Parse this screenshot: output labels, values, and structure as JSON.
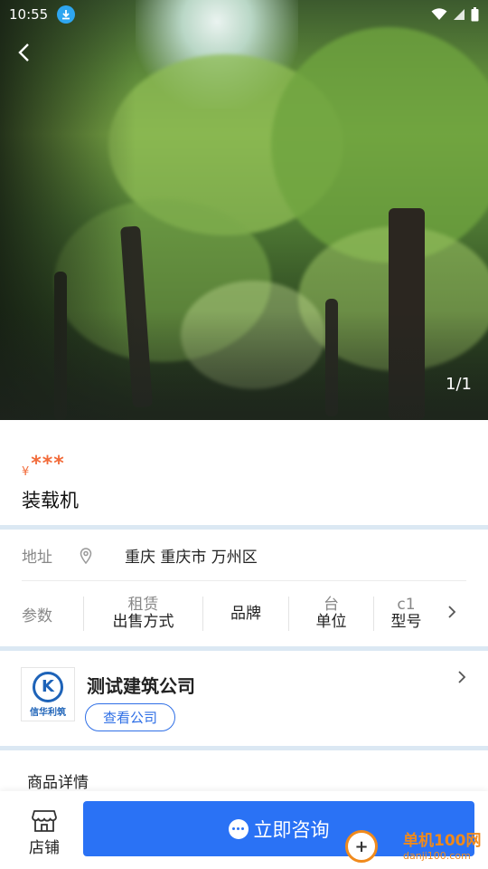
{
  "status_bar": {
    "time": "10:55"
  },
  "gallery": {
    "counter": "1/1"
  },
  "product": {
    "currency": "¥",
    "price": "***",
    "title": "装载机"
  },
  "address": {
    "label": "地址",
    "value": "重庆 重庆市 万州区"
  },
  "params": {
    "label": "参数",
    "items": [
      {
        "value": "租赁",
        "key": "出售方式"
      },
      {
        "value": "",
        "key": "品牌"
      },
      {
        "value": "台",
        "key": "单位"
      },
      {
        "value": "c1",
        "key": "型号"
      }
    ]
  },
  "company": {
    "name": "测试建筑公司",
    "button": "查看公司",
    "logo_text": "信华利筑"
  },
  "details": {
    "title": "商品详情"
  },
  "bottom": {
    "store_label": "店铺",
    "consult_label": "立即咨询"
  },
  "watermark": {
    "line1": "单机100网",
    "line2": "danji100.com"
  }
}
